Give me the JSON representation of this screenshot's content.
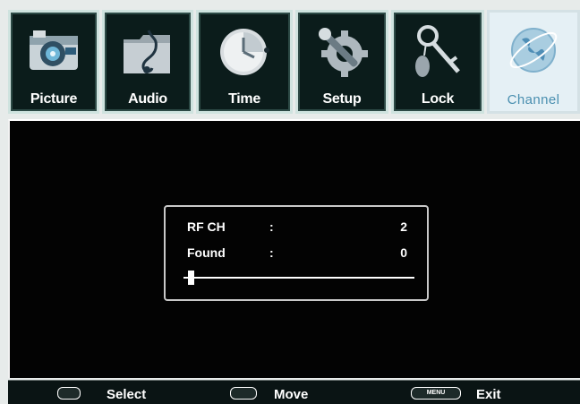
{
  "tabs": [
    {
      "label": "Picture",
      "icon": "camera-icon"
    },
    {
      "label": "Audio",
      "icon": "music-folder-icon"
    },
    {
      "label": "Time",
      "icon": "clock-icon"
    },
    {
      "label": "Setup",
      "icon": "tools-gear-icon"
    },
    {
      "label": "Lock",
      "icon": "key-icon"
    },
    {
      "label": "Channel",
      "icon": "globe-icon",
      "active": true
    }
  ],
  "scan": {
    "rf_label": "RF CH",
    "rf_colon": ":",
    "rf_value": "2",
    "found_label": "Found",
    "found_colon": ":",
    "found_value": "0",
    "progress_fraction": 0.02
  },
  "footer": {
    "select_label": "Select",
    "move_label": "Move",
    "menu_key_label": "MENU",
    "exit_label": "Exit"
  },
  "colors": {
    "active_tab_text": "#4a8fb0",
    "tab_border": "#cfe3df",
    "background": "#030303"
  }
}
